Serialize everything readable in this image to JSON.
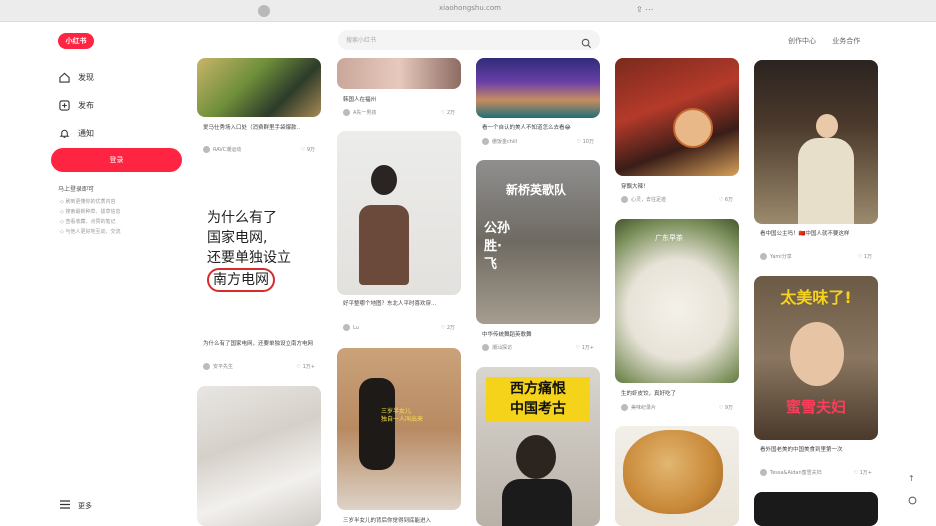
{
  "browser": {
    "url": "xiaohongshu.com"
  },
  "logo": {
    "text": "小红书"
  },
  "sidebar": {
    "items": [
      {
        "label": "发现",
        "icon": "home-icon"
      },
      {
        "label": "发布",
        "icon": "plus-square-icon"
      },
      {
        "label": "通知",
        "icon": "bell-icon"
      }
    ],
    "login_label": "登录",
    "tips_title": "马上登录即可",
    "tips": [
      "刷到更懂你的优质内容",
      "搜索最新种草、拔草信息",
      "查看收藏、点赞的笔记",
      "与他人更好地互动、交流"
    ],
    "more_label": "更多"
  },
  "search": {
    "placeholder": "搜索小红书"
  },
  "top_links": [
    "创作中心",
    "业务合作"
  ],
  "feed": {
    "col1": [
      {
        "title": "爱马仕秀场入口处（消费群里手袋爆款..",
        "author": "RAVC潮运动",
        "likes": "9万"
      },
      {
        "title": "为什么有了国家电网，还要单独设立南方电网",
        "author": "安平先生",
        "likes": "1万+",
        "thumb_text": [
          "为什么有了",
          "国家电网,",
          "还要单独设立",
          "南方电网"
        ]
      },
      {
        "title": "",
        "author": "",
        "likes": ""
      }
    ],
    "col2": [
      {
        "title": "韩国人在福州",
        "author": "A先一男孩",
        "likes": "2万"
      },
      {
        "title": "好平整哪个地图？东北人平时喜欢穿...",
        "author": "Lu",
        "likes": "2万"
      },
      {
        "title": "三岁半女儿的背后你觉得到底能进入",
        "author": "",
        "likes": "",
        "thumb_text": [
          "三岁半女儿",
          "独自一人叫出来"
        ]
      }
    ],
    "col3": [
      {
        "title": "看一个自认的美人不知道怎么去看😂",
        "author": "傲饭金chill",
        "likes": "10万"
      },
      {
        "title": "中华传统舞蹈英歌舞",
        "author": "潮汕探访",
        "likes": "1万+",
        "thumb_text": [
          "新桥英歌队",
          "公孙胜·飞"
        ]
      },
      {
        "title": "",
        "author": "",
        "likes": "",
        "thumb_text": [
          "西方痛恨",
          "中国考古"
        ]
      }
    ],
    "col4": [
      {
        "title": "穿飘大辣！",
        "author": "心灵，去往足迹",
        "likes": "6万"
      },
      {
        "title": "生的虾皮饺，真好吃了",
        "author": "美味纪录片",
        "likes": "9万",
        "thumb_text": [
          "广东早茶"
        ]
      },
      {
        "title": "",
        "author": "",
        "likes": ""
      }
    ],
    "col5": [
      {
        "title": "看中国公主吗！🇨🇳中国人就不要这样",
        "author": "Yami分享",
        "likes": "1万"
      },
      {
        "title": "看外国老美的中国美食到里第一次",
        "author": "Tessa&Aidan蜜雪夫妇",
        "likes": "1万+",
        "thumb_text": [
          "太美味了!",
          "蜜雪夫妇"
        ]
      },
      {
        "title": "",
        "author": "",
        "likes": ""
      }
    ]
  },
  "colors": {
    "brand": "#ff2442"
  }
}
